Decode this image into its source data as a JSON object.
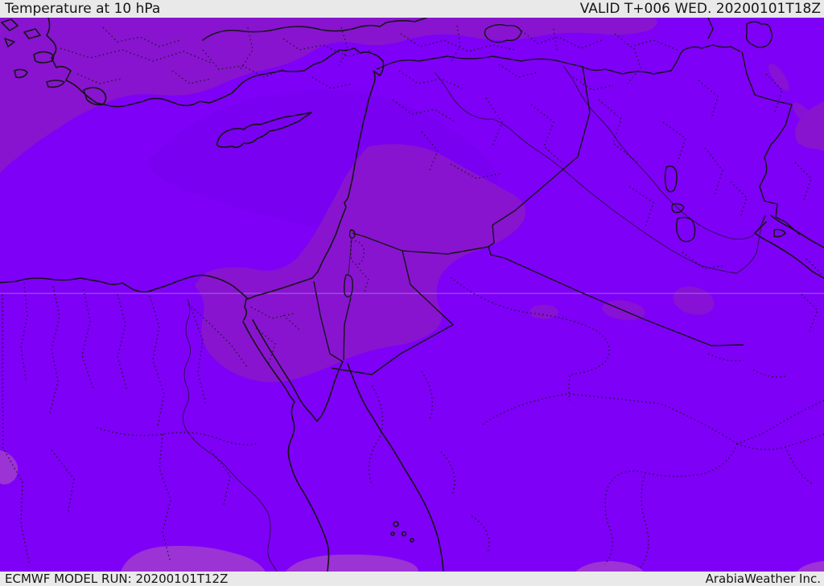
{
  "header": {
    "title": "Temperature at 10 hPa",
    "valid_label": "VALID T+006 WED. 20200101T18Z"
  },
  "footer": {
    "model_run_label": "ECMWF MODEL RUN: 20200101T12Z",
    "credit": "ArabiaWeather Inc."
  },
  "map": {
    "description": "ECMWF stratospheric temperature forecast map over the Middle East, uniform violet temperature shading with darker purple bands, black coastlines, solid country borders and dotted administrative boundaries",
    "colors": {
      "bar_background": "#e9e9e9",
      "bar_text": "#161616",
      "base_shade": "#7e00f6",
      "east_med_shade": "#7300e8",
      "muted_band_shade": "#8814cf",
      "warm_spot_shade": "#9c33d4",
      "line_color": "#151515",
      "gridline_color": "#b98cf2"
    }
  }
}
